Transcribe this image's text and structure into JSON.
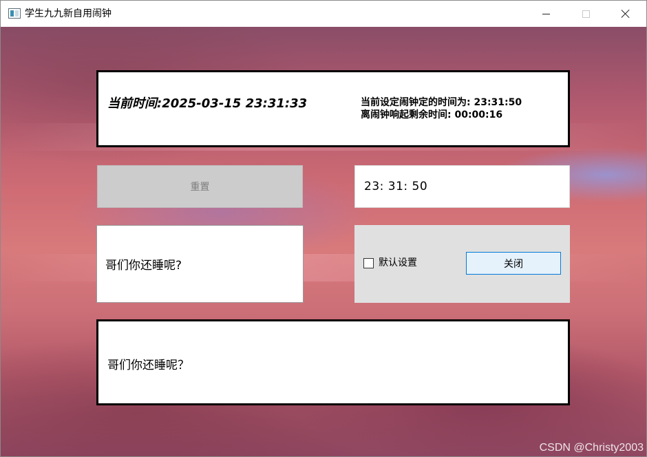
{
  "window": {
    "title": "学生九九新自用闹钟"
  },
  "icons": {
    "app": "app-window-icon",
    "minimize": "minimize-icon",
    "maximize": "maximize-icon",
    "close": "close-icon"
  },
  "clock": {
    "current_time": "当前时间:2025-03-15  23:31:33",
    "alarm_set_time": "当前设定闹钟定的时间为: 23:31:50",
    "remaining_time": "离闹钟响起剩余时间: 00:00:16"
  },
  "controls": {
    "reset_label": "重置",
    "time_input_value": "23: 31: 50",
    "message_text": "哥们你还睡呢?",
    "default_settings_label": "默认设置",
    "default_settings_checked": false,
    "close_label": "关闭"
  },
  "bottom": {
    "message": "哥们你还睡呢？"
  },
  "watermark": "CSDN @Christy2003",
  "colors": {
    "accent_border": "#0078d7",
    "close_button_bg": "#e5f1fb",
    "disabled_button_bg": "#cccccc",
    "panel_bg": "#e0e0e0"
  }
}
